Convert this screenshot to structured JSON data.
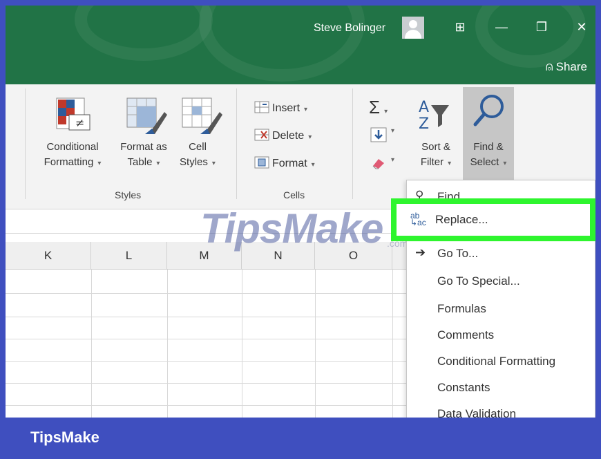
{
  "titlebar": {
    "user_name": "Steve Bolinger",
    "share_label": "Share",
    "share_icon": "person-add-icon",
    "colors": {
      "accent": "#217346",
      "highlight": "#2ef52e",
      "brand": "#3f4fbf"
    }
  },
  "ribbon": {
    "styles": {
      "group_label": "Styles",
      "conditional_formatting": [
        "Conditional",
        "Formatting"
      ],
      "format_as_table": [
        "Format as",
        "Table"
      ],
      "cell_styles": [
        "Cell",
        "Styles"
      ]
    },
    "cells": {
      "group_label": "Cells",
      "insert": "Insert",
      "delete": "Delete",
      "format": "Format"
    },
    "editing": {
      "autosum_icon": "Σ",
      "sort_filter": [
        "Sort &",
        "Filter"
      ],
      "find_select": [
        "Find &",
        "Select"
      ]
    }
  },
  "grid": {
    "columns": [
      "K",
      "L",
      "M",
      "N",
      "O"
    ]
  },
  "watermark": {
    "text": "TipsMake",
    "sub": ".com"
  },
  "menu": {
    "items": [
      {
        "label": "Find",
        "icon": "search-icon"
      },
      {
        "label": "Replace...",
        "icon": "replace-icon"
      },
      {
        "label": "Go To...",
        "icon": "arrow-right-icon"
      },
      {
        "label": "Go To Special...",
        "icon": ""
      },
      {
        "label": "Formulas",
        "icon": ""
      },
      {
        "label": "Comments",
        "icon": ""
      },
      {
        "label": "Conditional Formatting",
        "icon": ""
      },
      {
        "label": "Constants",
        "icon": ""
      },
      {
        "label": "Data Validation",
        "icon": ""
      }
    ]
  },
  "footer": {
    "brand": "TipsMake"
  }
}
